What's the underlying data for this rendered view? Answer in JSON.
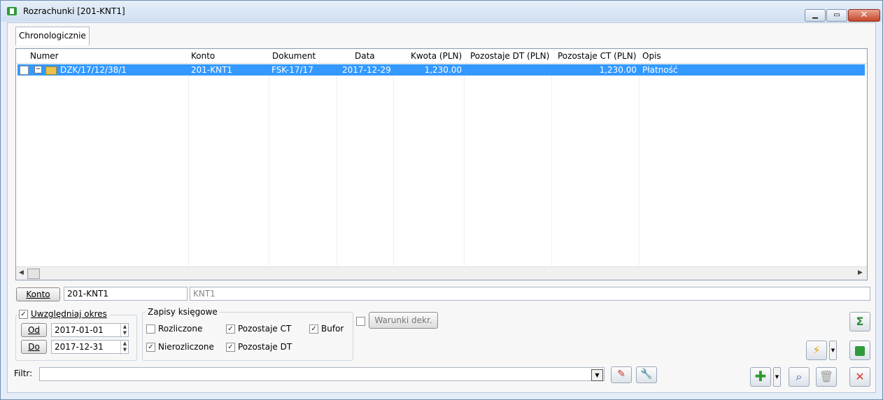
{
  "window": {
    "title": "Rozrachunki [201-KNT1]"
  },
  "tabs": [
    {
      "label": "Chronologicznie"
    }
  ],
  "grid": {
    "columns": [
      "Numer",
      "Konto",
      "Dokument",
      "Data",
      "Kwota (PLN)",
      "Pozostaje DT (PLN)",
      "Pozostaje CT (PLN)",
      "Opis"
    ],
    "rows": [
      {
        "numer": "DZK/17/12/38/1",
        "konto": "201-KNT1",
        "dokument": "FSK-17/17",
        "data": "2017-12-29",
        "kwota": "1,230.00",
        "pozostaje_dt": "",
        "pozostaje_ct": "1,230.00",
        "opis": "Płatność"
      }
    ]
  },
  "konto": {
    "button_label": "Konto",
    "value": "201-KNT1",
    "description": "KNT1"
  },
  "okres": {
    "checkbox_label": "Uwzględniaj okres",
    "checked": true,
    "od_label": "Od",
    "od_value": "2017-01-01",
    "do_label": "Do",
    "do_value": "2017-12-31"
  },
  "zapisy": {
    "group_label": "Zapisy księgowe",
    "rozliczone": {
      "label": "Rozliczone",
      "checked": false
    },
    "nierozliczone": {
      "label": "Nierozliczone",
      "checked": true
    },
    "pozostaje_ct": {
      "label": "Pozostaje CT",
      "checked": true
    },
    "pozostaje_dt": {
      "label": "Pozostaje DT",
      "checked": true
    },
    "bufor": {
      "label": "Bufor",
      "checked": true
    }
  },
  "warunki": {
    "label": "Warunki dekr.",
    "checked": false
  },
  "filtr": {
    "label": "Filtr:",
    "value": ""
  },
  "icons": {
    "sum": "sum-icon",
    "lightning": "lightning-icon",
    "app": "app-logo-icon",
    "add": "plus-icon",
    "search": "magnifier-icon",
    "delete": "trash-icon",
    "close": "close-icon",
    "filter_clear": "eraser-icon",
    "filter_build": "wrench-icon"
  },
  "colors": {
    "selection": "#3399ff",
    "add": "#2e9b2e",
    "close": "#d93b2b",
    "sum": "#2e8b3a"
  }
}
